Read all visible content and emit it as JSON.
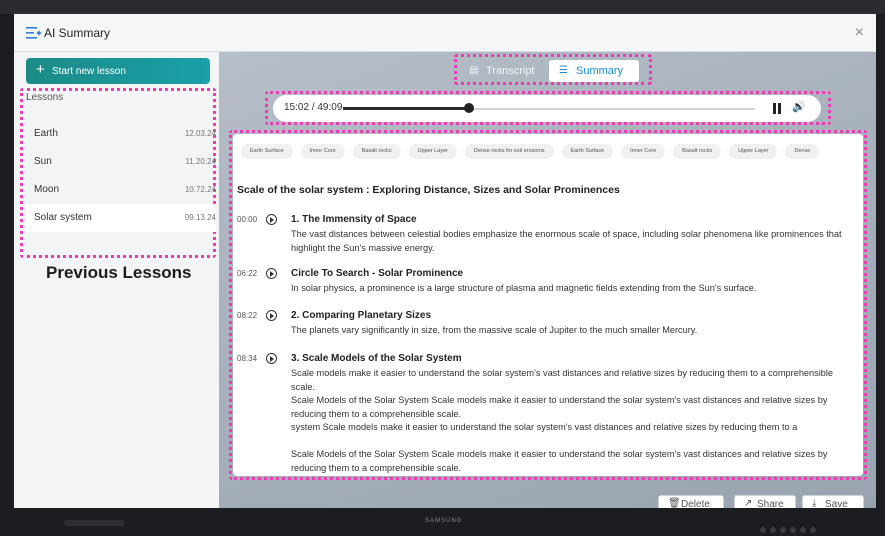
{
  "window": {
    "title": "AI Summary",
    "close_icon": "close-icon"
  },
  "sidebar": {
    "new_lesson_label": "Start new lesson",
    "lessons_heading": "Lessons",
    "lessons": [
      {
        "name": "Earth",
        "date": "12.03.24"
      },
      {
        "name": "Sun",
        "date": "11.20.24"
      },
      {
        "name": "Moon",
        "date": "10.72.24"
      },
      {
        "name": "Solar system",
        "date": "09.13.24",
        "selected": true
      }
    ],
    "annotation": "Previous Lessons"
  },
  "tabs": [
    {
      "label": "Transcript",
      "icon": "transcript-icon"
    },
    {
      "label": "Summary",
      "icon": "summary-icon",
      "active": true
    }
  ],
  "player": {
    "time": "15:02 / 49:09",
    "progress": 0.306
  },
  "keywords": [
    "Earth Surface",
    "Inner Core",
    "Basalt rocks",
    "Upper Layer",
    "Dense rocks for soil erosions",
    "Earth Surface",
    "Inner Core",
    "Basalt rocks",
    "Upper Layer",
    "Dense"
  ],
  "summary": {
    "title": "Scale of the solar system : Exploring Distance, Sizes and Solar Prominences",
    "sections": [
      {
        "time": "00:00",
        "heading": "1. The Immensity of Space",
        "paragraphs": [
          "The vast distances between celestial bodies emphasize the enormous scale of space, including solar phenomena like prominences that highlight the Sun's massive energy."
        ]
      },
      {
        "time": "06:22",
        "heading": "Circle To Search - Solar Prominence",
        "paragraphs": [
          "In solar physics, a prominence is a large structure of plasma and magnetic fields extending from the Sun's surface."
        ]
      },
      {
        "time": "08:22",
        "heading": "2. Comparing Planetary Sizes",
        "paragraphs": [
          "The planets vary significantly in size, from the massive scale of Jupiter to the much smaller Mercury."
        ]
      },
      {
        "time": "08:34",
        "heading": "3. Scale Models of the Solar System",
        "paragraphs": [
          "Scale models make it easier to understand the solar system's vast distances and relative sizes by reducing them to a comprehensible scale.",
          "Scale Models of the Solar System Scale models make it easier to understand the solar system's vast distances and relative sizes by reducing them to a comprehensible scale.",
          "system Scale models make it easier to understand the solar system's vast distances and relative sizes by reducing them to a",
          "",
          "Scale Models of the Solar System Scale models make it easier to understand the solar system's vast distances and relative sizes by reducing them to a comprehensible scale."
        ]
      }
    ]
  },
  "footer": {
    "delete_label": "Delete",
    "share_label": "Share",
    "save_label": "Save"
  },
  "device": {
    "brand": "SAMSUNG"
  },
  "colors": {
    "accent": "#1aa0a9",
    "annotation": "#f03cb4",
    "summary_tab": "#1a8bd6"
  }
}
